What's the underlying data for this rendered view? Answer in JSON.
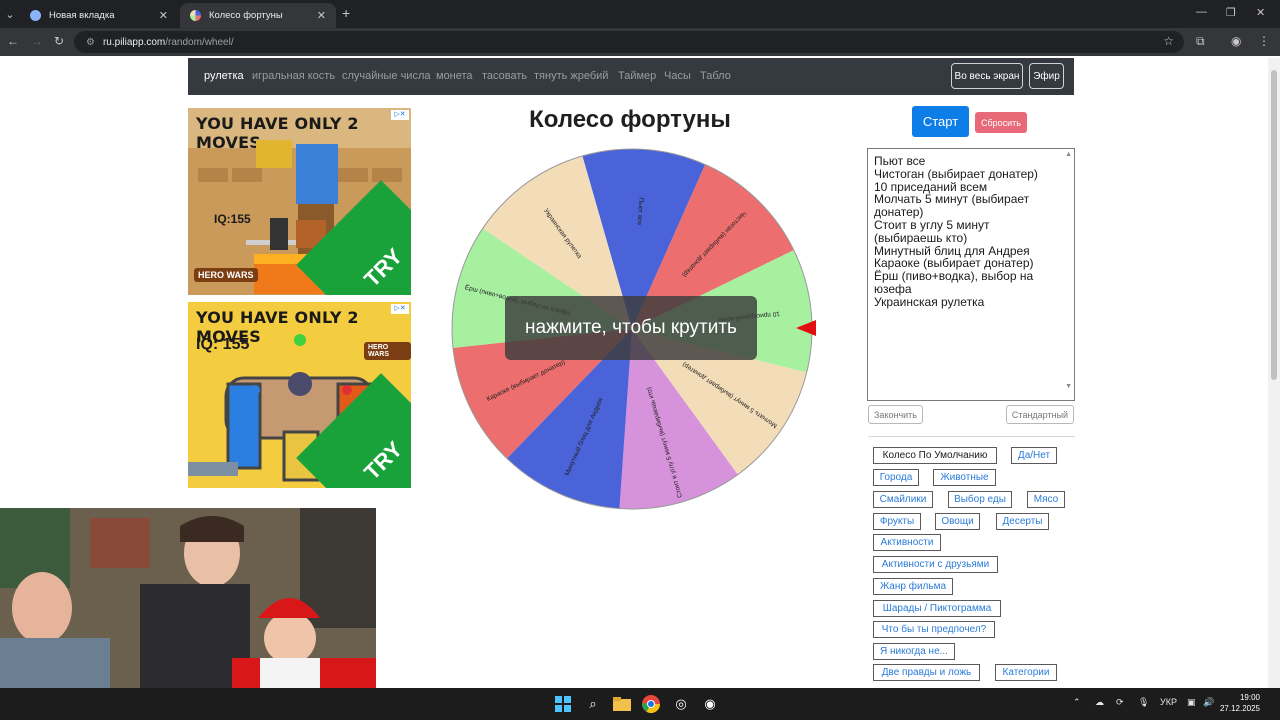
{
  "browser": {
    "tabs": [
      {
        "title": "Новая вкладка",
        "active": false
      },
      {
        "title": "Колесо фортуны",
        "active": true
      }
    ],
    "url_site": "ru.piliapp.com",
    "url_path": "/random/wheel/",
    "icons": [
      "tab-search-icon",
      "close-icon",
      "new-tab-icon",
      "minimize-icon",
      "maximize-icon",
      "window-close-icon",
      "back-icon",
      "forward-icon",
      "reload-icon",
      "site-info-icon",
      "star-icon",
      "extensions-icon",
      "profile-icon",
      "menu-icon"
    ]
  },
  "site_nav": {
    "items": [
      "рулетка",
      "игральная кость",
      "случайные числа",
      "монета",
      "тасовать",
      "тянуть жребий",
      "Таймер",
      "Часы",
      "Табло"
    ],
    "active_index": 0,
    "fullscreen_label": "Во весь экран",
    "broadcast_label": "Эфир"
  },
  "ads": [
    {
      "title": "YOU HAVE ONLY 2 MOVES",
      "iq": "IQ:155",
      "logo": "HERO WARS",
      "cta": "TRY"
    },
    {
      "title": "YOU HAVE ONLY 2 MOVES",
      "iq": "IQ: 155",
      "logo": "HERO WARS",
      "cta": "TRY"
    }
  ],
  "wheel": {
    "title": "Колесо фортуны",
    "overlay_text": "нажмите, чтобы крутить",
    "pointer_color": "#e01010",
    "segments": [
      {
        "label": "Пьют все",
        "color": "#4a63d8"
      },
      {
        "label": "Чистоган (выбирает донатер)",
        "color": "#ec6e6e"
      },
      {
        "label": "10 приседаний всем",
        "color": "#a6f0a0"
      },
      {
        "label": "Молчать 5 минут (выбирает донатер)",
        "color": "#f3dcb8"
      },
      {
        "label": "Стоит в углу 5 минут (выбираешь кто)",
        "color": "#d792dc"
      },
      {
        "label": "Минутный блиц для Андрея",
        "color": "#4a63d8"
      },
      {
        "label": "Караоке (выбирает донатер)",
        "color": "#ec6e6e"
      },
      {
        "label": "Ёрш (пиво+водка), выбор на юзефа",
        "color": "#a6f0a0"
      },
      {
        "label": "Украинская рулетка",
        "color": "#f3dcb8"
      }
    ]
  },
  "panel": {
    "start_label": "Старт",
    "reset_label": "Сбросить",
    "entries": [
      "Пьют все",
      "Чистоган (выбирает донатер)",
      "10 приседаний всем",
      "Молчать 5 минут (выбирает",
      "донатер)",
      "Стоит в углу 5 минут",
      "(выбираешь кто)",
      "Минутный блиц для Андрея",
      "Караоке (выбирает донатер)",
      "Ёрш (пиво+водка), выбор на",
      "юзефа",
      "Украинская рулетка"
    ],
    "finish_label": "Закончить",
    "standard_label": "Стандартный",
    "presets": [
      "Колесо По Умолчанию",
      "Да/Нет",
      "Города",
      "Животные",
      "Смайлики",
      "Выбор еды",
      "Мясо",
      "Фрукты",
      "Овощи",
      "Десерты",
      "Активности",
      "Активности с друзьями",
      "Жанр фильма",
      "Шарады / Пиктограмма",
      "Что бы ты предпочел?",
      "Я никогда не...",
      "Две правды и ложь",
      "Категории"
    ]
  },
  "taskbar": {
    "lang": "УКР",
    "time": "19:00",
    "date": "27.12.2025"
  }
}
